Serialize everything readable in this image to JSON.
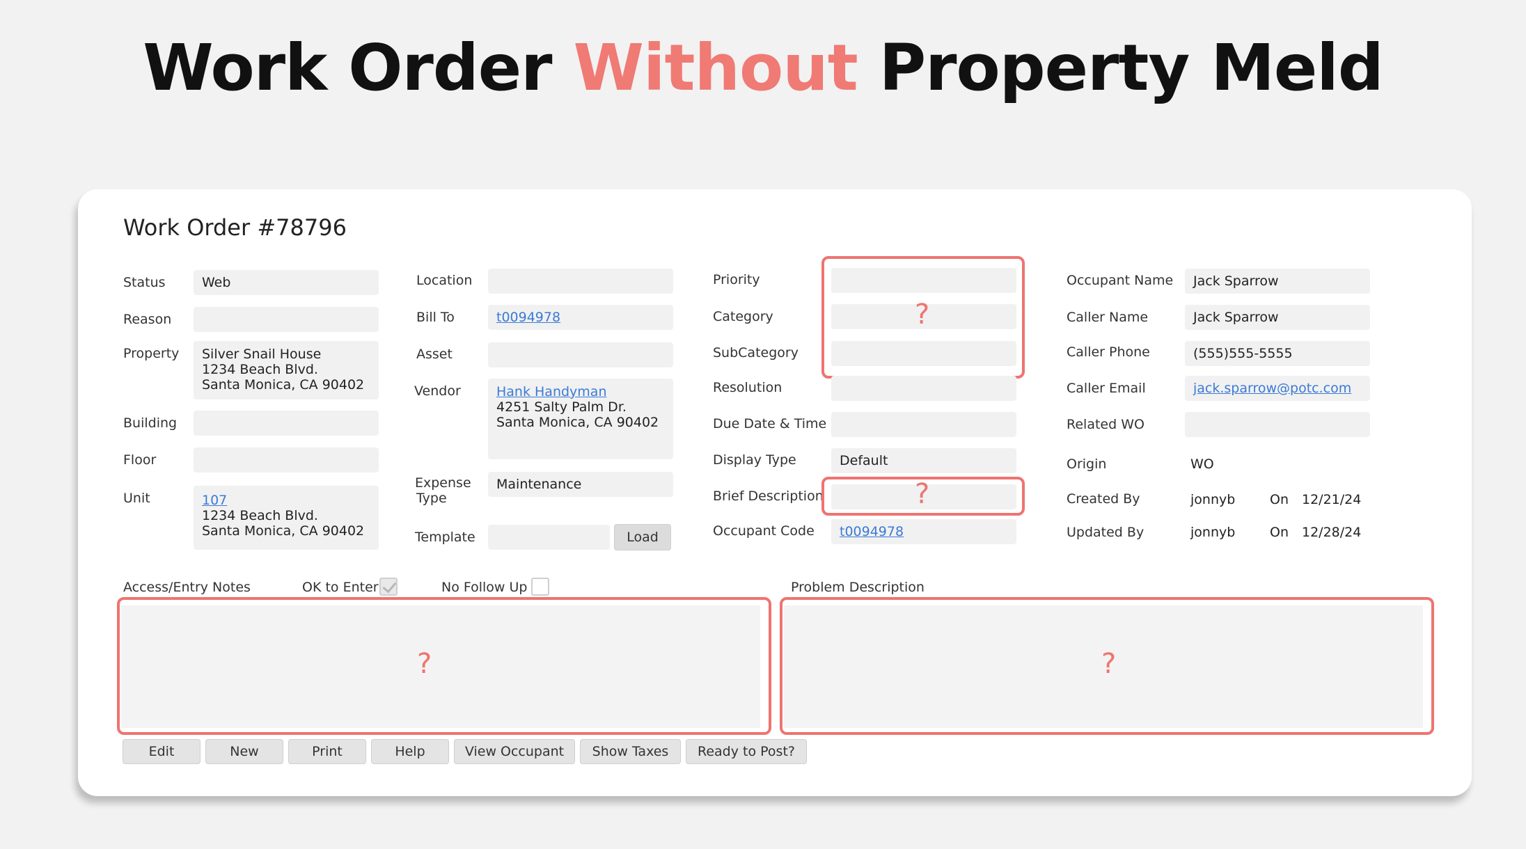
{
  "headline": {
    "part1": "Work Order ",
    "accent": "Without",
    "part2": " Property Meld"
  },
  "form": {
    "title": "Work Order #78796",
    "col1": {
      "status_label": "Status",
      "status_value": "Web",
      "reason_label": "Reason",
      "reason_value": "",
      "property_label": "Property",
      "property_lines": [
        "Silver Snail House",
        "1234 Beach Blvd.",
        "Santa Monica, CA 90402"
      ],
      "building_label": "Building",
      "building_value": "",
      "floor_label": "Floor",
      "floor_value": "",
      "unit_label": "Unit",
      "unit_link": "107",
      "unit_lines": [
        "1234 Beach Blvd.",
        "Santa Monica, CA 90402"
      ]
    },
    "col2": {
      "location_label": "Location",
      "location_value": "",
      "billto_label": "Bill To",
      "billto_link": "t0094978",
      "asset_label": "Asset",
      "asset_value": "",
      "vendor_label": "Vendor",
      "vendor_link": "Hank Handyman",
      "vendor_lines": [
        "4251 Salty Palm Dr.",
        "Santa Monica, CA 90402"
      ],
      "expense_label_1": "Expense",
      "expense_label_2": "Type",
      "expense_value": "Maintenance",
      "template_label": "Template",
      "template_value": "",
      "load_label": "Load"
    },
    "col3": {
      "priority_label": "Priority",
      "priority_value": "",
      "category_label": "Category",
      "category_value": "",
      "subcategory_label": "SubCategory",
      "subcategory_value": "",
      "resolution_label": "Resolution",
      "resolution_value": "",
      "duedate_label": "Due Date & Time",
      "duedate_value": "",
      "displaytype_label": "Display Type",
      "displaytype_value": "Default",
      "brief_label": "Brief Description",
      "brief_value": "",
      "occcode_label": "Occupant Code",
      "occcode_link": "t0094978",
      "question_mark": "?"
    },
    "col4": {
      "occname_label": "Occupant Name",
      "occname_value": "Jack Sparrow",
      "callername_label": "Caller Name",
      "callername_value": "Jack Sparrow",
      "callerphone_label": "Caller Phone",
      "callerphone_value": "(555)555-5555",
      "calleremail_label": "Caller Email",
      "calleremail_link": "jack.sparrow@potc.com",
      "relatedwo_label": "Related WO",
      "relatedwo_value": "",
      "origin_label": "Origin",
      "origin_value": "WO",
      "createdby_label": "Created By",
      "createdby_value": "jonnyb",
      "on_label": "On",
      "created_on": "12/21/24",
      "updatedby_label": "Updated By",
      "updatedby_value": "jonnyb",
      "updated_on": "12/28/24"
    },
    "notes": {
      "access_label": "Access/Entry Notes",
      "ok_to_enter_label": "OK to Enter",
      "ok_to_enter_checked": true,
      "no_follow_up_label": "No Follow Up",
      "no_follow_up_checked": false,
      "problem_label": "Problem Description",
      "question_mark": "?"
    },
    "buttons": {
      "edit": "Edit",
      "new": "New",
      "print": "Print",
      "help": "Help",
      "view_occupant": "View Occupant",
      "show_taxes": "Show Taxes",
      "ready_to_post": "Ready to Post?"
    }
  },
  "colors": {
    "accent": "#ee7470",
    "link": "#3b7bd6",
    "field": "#f1f1f1"
  }
}
